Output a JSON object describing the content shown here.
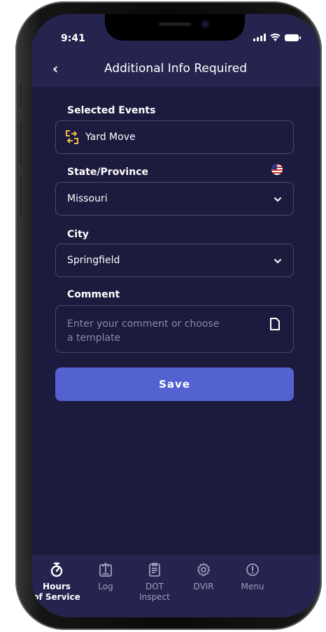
{
  "status_bar": {
    "time": "9:41"
  },
  "header": {
    "back_symbol": "‹",
    "title": "Additional Info Required"
  },
  "form": {
    "selected_events_label": "Selected Events",
    "selected_event_value": "Yard Move",
    "state_label": "State/Province",
    "state_value": "Missouri",
    "city_label": "City",
    "city_value": "Springfield",
    "comment_label": "Comment",
    "comment_placeholder_line1": "Enter your comment or choose",
    "comment_placeholder_line2": "a template",
    "save_label": "Save"
  },
  "nav": {
    "items": [
      {
        "label_line1": "Hours",
        "label_line2": "of Service",
        "icon": "stopwatch-icon",
        "active": true
      },
      {
        "label_line1": "Log",
        "label_line2": "",
        "icon": "log-upload-icon",
        "active": false
      },
      {
        "label_line1": "DOT",
        "label_line2": "Inspect",
        "icon": "clipboard-icon",
        "active": false
      },
      {
        "label_line1": "DVIR",
        "label_line2": "",
        "icon": "gear-icon",
        "active": false
      },
      {
        "label_line1": "Menu",
        "label_line2": "",
        "icon": "info-icon",
        "active": false
      }
    ]
  },
  "colors": {
    "background": "#1c1a3d",
    "header_bg": "#25244f",
    "accent": "#5462d1",
    "event_icon": "#f0b84a",
    "field_border": "#4b4a6e"
  }
}
